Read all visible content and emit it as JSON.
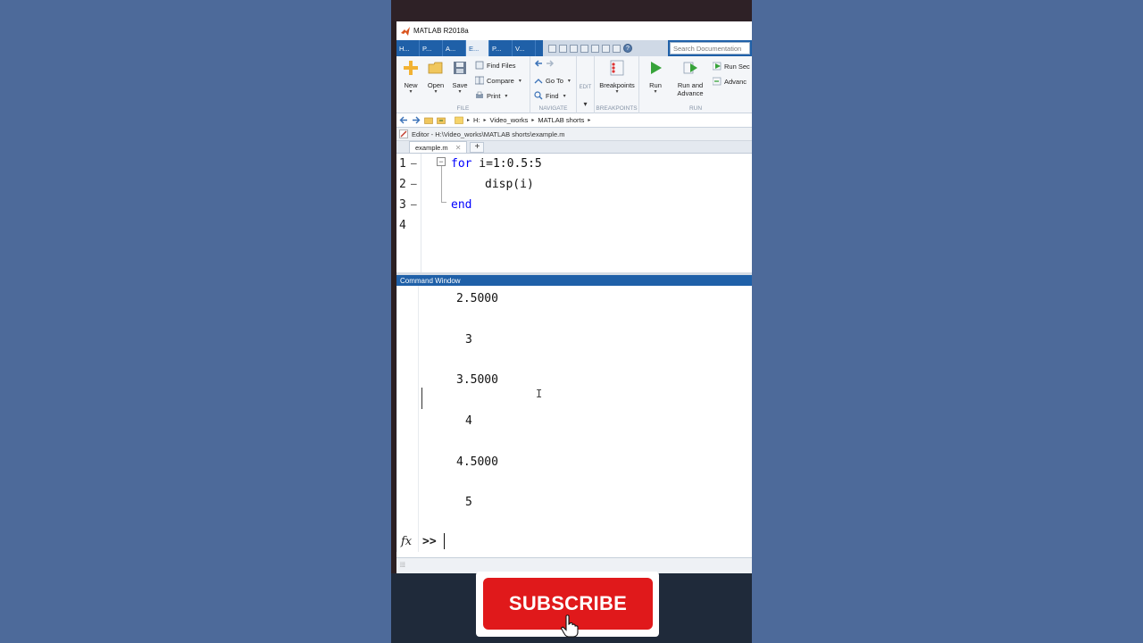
{
  "window": {
    "title": "MATLAB R2018a"
  },
  "tabs": [
    {
      "label": "H..."
    },
    {
      "label": "P..."
    },
    {
      "label": "A..."
    },
    {
      "label": "E..."
    },
    {
      "label": "P..."
    },
    {
      "label": "V..."
    }
  ],
  "search": {
    "placeholder": "Search Documentation"
  },
  "ribbon": {
    "file": {
      "label": "FILE",
      "new": "New",
      "open": "Open",
      "save": "Save",
      "find_files": "Find Files",
      "compare": "Compare",
      "print": "Print"
    },
    "navigate": {
      "label": "NAVIGATE",
      "go_to": "Go To",
      "find": "Find"
    },
    "edit": {
      "label": "EDIT"
    },
    "breakpoints": {
      "label": "BREAKPOINTS",
      "button": "Breakpoints"
    },
    "run": {
      "label": "RUN",
      "run": "Run",
      "run_and_advance_1": "Run and",
      "run_and_advance_2": "Advance",
      "run_section": "Run Sec",
      "advance": "Advanc"
    }
  },
  "address": {
    "drive": "H:",
    "folder1": "Video_works",
    "folder2": "MATLAB shorts"
  },
  "editor": {
    "header": "Editor - H:\\Video_works\\MATLAB shorts\\example.m",
    "tab": "example.m",
    "lines": [
      {
        "num": "1",
        "keyword": "for",
        "rest": " i=1:0.5:5"
      },
      {
        "num": "2",
        "code": "disp(i)"
      },
      {
        "num": "3",
        "keyword": "end"
      },
      {
        "num": "4"
      }
    ]
  },
  "command_window": {
    "title": "Command Window",
    "outputs": [
      "2.5000",
      "3",
      "3.5000",
      "4",
      "4.5000",
      "5"
    ],
    "fx": "fx",
    "prompt": ">>"
  },
  "subscribe": {
    "label": "SUBSCRIBE"
  },
  "colors": {
    "accent": "#1f60a8",
    "keyword": "#0000ff",
    "subscribe": "#e0191b",
    "background": "#4d6a9a"
  }
}
